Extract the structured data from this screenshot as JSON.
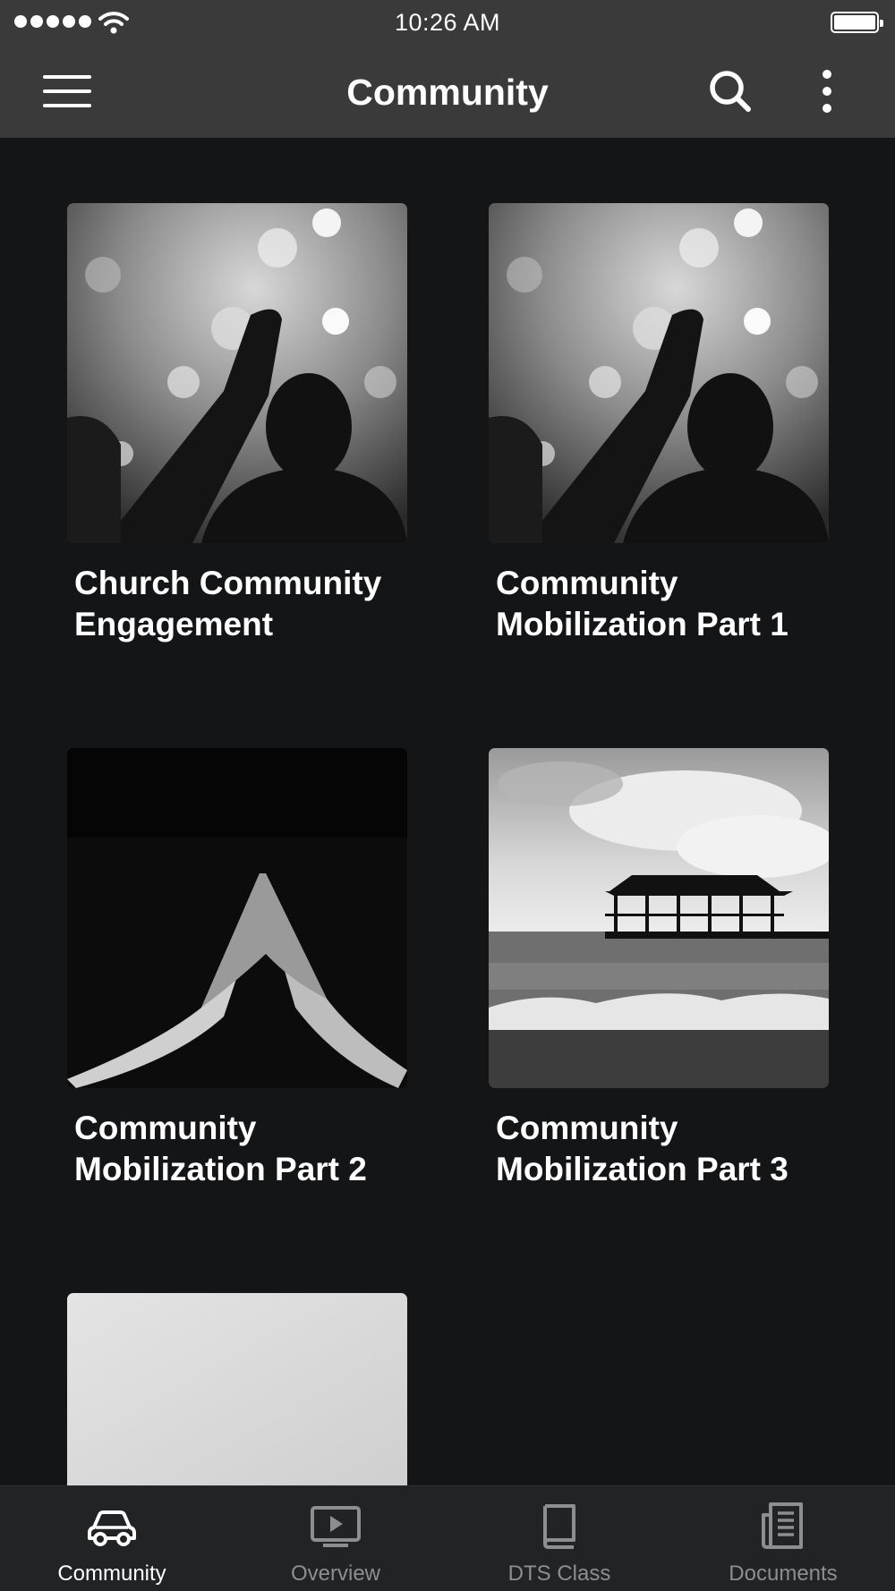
{
  "status_bar": {
    "time": "10:26 AM"
  },
  "nav": {
    "title": "Community"
  },
  "cards": [
    {
      "title": "Church Community Engagement"
    },
    {
      "title": "Community Mobilization Part 1"
    },
    {
      "title": "Community Mobilization Part 2"
    },
    {
      "title": "Community Mobilization Part 3"
    },
    {
      "title": ""
    }
  ],
  "tabs": [
    {
      "label": "Community",
      "icon": "car-icon",
      "active": true
    },
    {
      "label": "Overview",
      "icon": "video-player-icon",
      "active": false
    },
    {
      "label": "DTS Class",
      "icon": "book-icon",
      "active": false
    },
    {
      "label": "Documents",
      "icon": "document-icon",
      "active": false
    }
  ],
  "colors": {
    "bar": "#3a3a3b",
    "background": "#141517",
    "tab_bar": "#222325",
    "inactive_tab": "#8d8e90"
  }
}
